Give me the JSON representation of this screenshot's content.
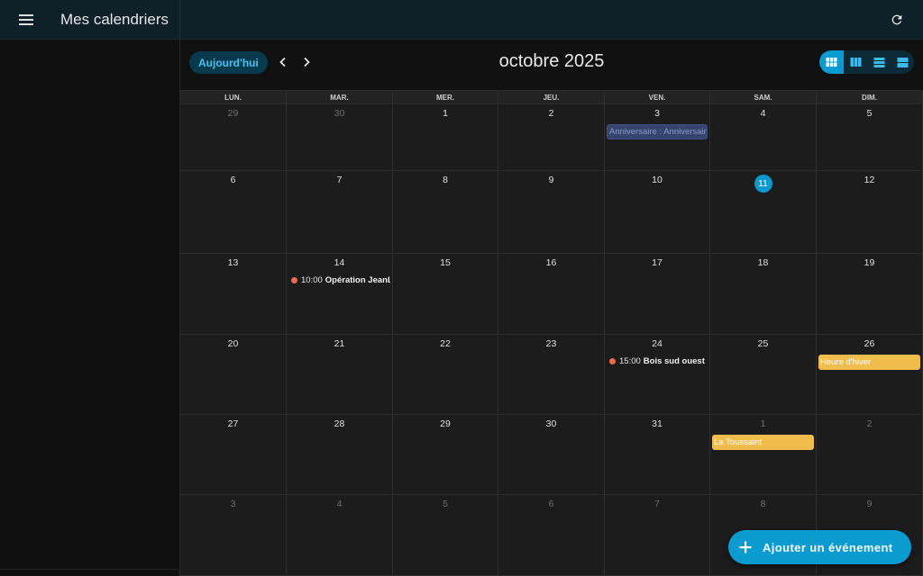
{
  "app": {
    "title": "Mes calendriers"
  },
  "toolbar": {
    "today_label": "Aujourd'hui",
    "month_title": "octobre 2025",
    "views": [
      {
        "icon": "month-grid-icon",
        "active": true
      },
      {
        "icon": "week-columns-icon",
        "active": false
      },
      {
        "icon": "list-icon",
        "active": false
      },
      {
        "icon": "day-rows-icon",
        "active": false
      }
    ]
  },
  "calendar": {
    "weekdays": [
      "LUN.",
      "MAR.",
      "MER.",
      "JEU.",
      "VEN.",
      "SAM.",
      "DIM."
    ],
    "weeks": [
      {
        "days": [
          {
            "num": "29",
            "other": true
          },
          {
            "num": "30",
            "other": true
          },
          {
            "num": "1"
          },
          {
            "num": "2"
          },
          {
            "num": "3",
            "events": [
              {
                "kind": "anniv",
                "title": "Anniversaire : Anniversaire"
              }
            ]
          },
          {
            "num": "4"
          },
          {
            "num": "5"
          }
        ]
      },
      {
        "days": [
          {
            "num": "6"
          },
          {
            "num": "7"
          },
          {
            "num": "8"
          },
          {
            "num": "9"
          },
          {
            "num": "10"
          },
          {
            "num": "11",
            "today": true
          },
          {
            "num": "12"
          }
        ]
      },
      {
        "days": [
          {
            "num": "13"
          },
          {
            "num": "14",
            "events": [
              {
                "kind": "dot",
                "time": "10:00",
                "title": "Opération JeanLo"
              }
            ]
          },
          {
            "num": "15"
          },
          {
            "num": "16"
          },
          {
            "num": "17"
          },
          {
            "num": "18"
          },
          {
            "num": "19"
          }
        ]
      },
      {
        "days": [
          {
            "num": "20"
          },
          {
            "num": "21"
          },
          {
            "num": "22"
          },
          {
            "num": "23"
          },
          {
            "num": "24",
            "events": [
              {
                "kind": "dot",
                "time": "15:00",
                "title": "Bois sud ouest"
              }
            ]
          },
          {
            "num": "25"
          },
          {
            "num": "26",
            "events": [
              {
                "kind": "yellow",
                "title": "Heure d'hiver"
              }
            ]
          }
        ]
      },
      {
        "days": [
          {
            "num": "27"
          },
          {
            "num": "28"
          },
          {
            "num": "29"
          },
          {
            "num": "30"
          },
          {
            "num": "31"
          },
          {
            "num": "1",
            "other": true,
            "events": [
              {
                "kind": "yellow",
                "title": "La Toussaint"
              }
            ]
          },
          {
            "num": "2",
            "other": true
          }
        ]
      },
      {
        "days": [
          {
            "num": "3",
            "other": true
          },
          {
            "num": "4",
            "other": true
          },
          {
            "num": "5",
            "other": true
          },
          {
            "num": "6",
            "other": true
          },
          {
            "num": "7",
            "other": true
          },
          {
            "num": "8",
            "other": true
          },
          {
            "num": "9",
            "other": true
          }
        ]
      }
    ]
  },
  "fab": {
    "label": "Ajouter un événement"
  },
  "colors": {
    "accent": "#0a9bd1",
    "event_dot": "#ef6b4a",
    "holiday": "#f0bc4b",
    "anniversary": "#36456f"
  }
}
